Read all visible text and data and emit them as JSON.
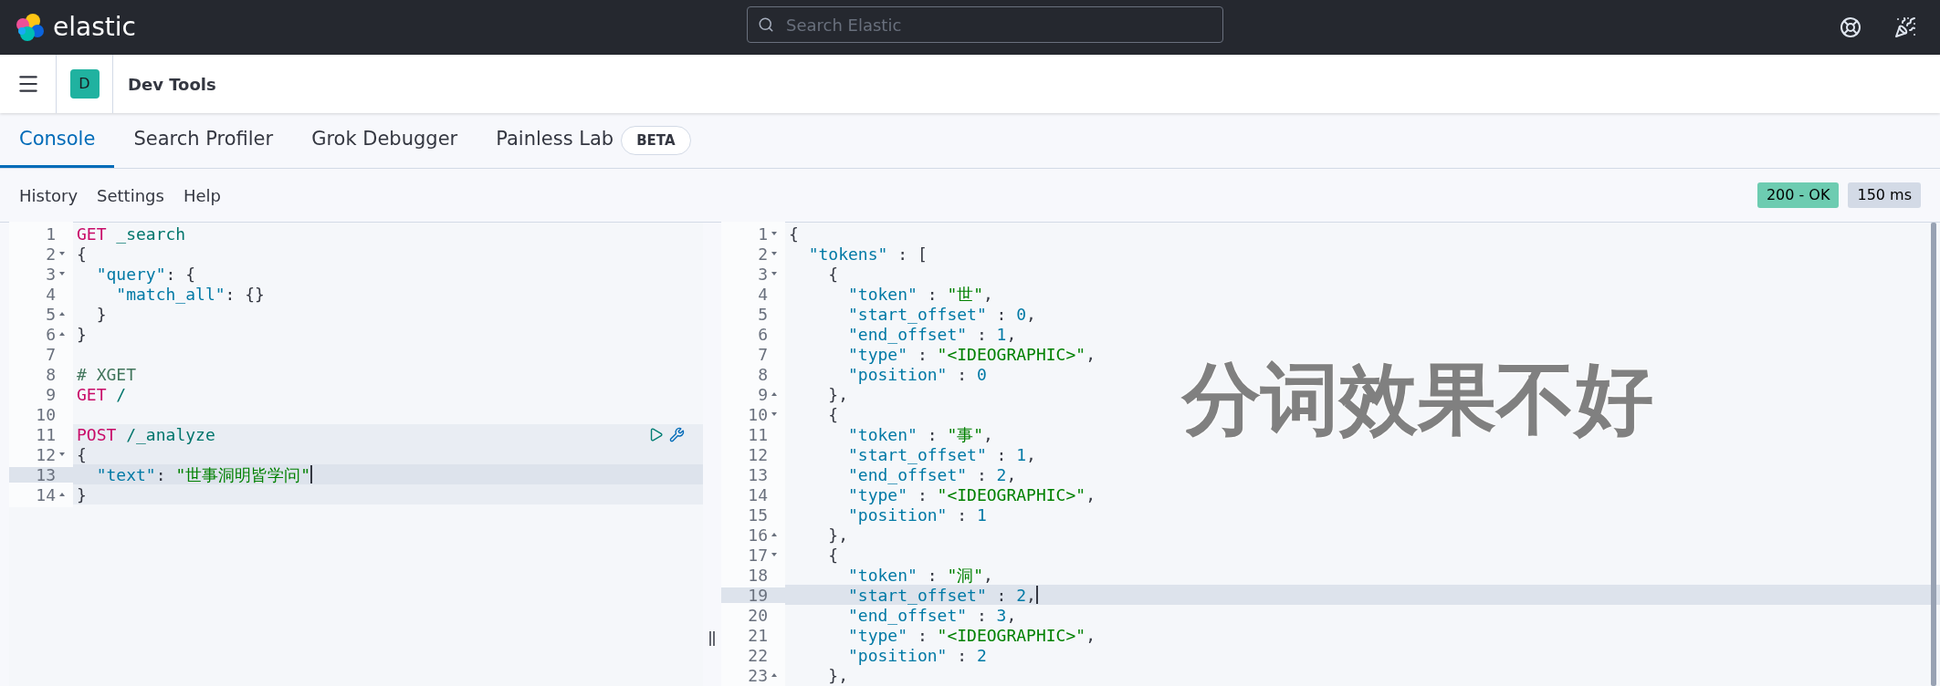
{
  "header": {
    "brand": "elastic",
    "search": {
      "placeholder": "Search Elastic"
    }
  },
  "breadcrumb": {
    "avatar": "D",
    "title": "Dev Tools"
  },
  "tabs": [
    {
      "label": "Console",
      "selected": true
    },
    {
      "label": "Search Profiler",
      "selected": false
    },
    {
      "label": "Grok Debugger",
      "selected": false
    },
    {
      "label": "Painless Lab",
      "selected": false,
      "badge": "BETA"
    }
  ],
  "toolbar": {
    "links": [
      "History",
      "Settings",
      "Help"
    ],
    "status": "200 - OK",
    "duration": "150 ms"
  },
  "request_editor": {
    "lines": [
      {
        "number": "1",
        "tokens": [
          {
            "kind": "method",
            "text": "GET"
          },
          {
            "kind": "path",
            "text": " _search"
          }
        ]
      },
      {
        "number": "2",
        "fold_start": true,
        "tokens": [
          {
            "kind": "punct",
            "text": "{"
          }
        ]
      },
      {
        "number": "3",
        "fold_start": true,
        "tokens": [
          {
            "kind": "key",
            "text": "  \"query\""
          },
          {
            "kind": "punct",
            "text": ": {"
          }
        ]
      },
      {
        "number": "4",
        "tokens": [
          {
            "kind": "key",
            "text": "    \"match_all\""
          },
          {
            "kind": "punct",
            "text": ": {}"
          }
        ]
      },
      {
        "number": "5",
        "fold_end": true,
        "tokens": [
          {
            "kind": "punct",
            "text": "  }"
          }
        ]
      },
      {
        "number": "6",
        "fold_end": true,
        "tokens": [
          {
            "kind": "punct",
            "text": "}"
          }
        ]
      },
      {
        "number": "7"
      },
      {
        "number": "8",
        "tokens": [
          {
            "kind": "comment",
            "text": "# XGET"
          }
        ]
      },
      {
        "number": "9",
        "tokens": [
          {
            "kind": "method",
            "text": "GET"
          },
          {
            "kind": "path",
            "text": " /"
          }
        ]
      },
      {
        "number": "10"
      },
      {
        "number": "11",
        "highlighted": true,
        "actions": true,
        "tokens": [
          {
            "kind": "method",
            "text": "POST"
          },
          {
            "kind": "path",
            "text": " /_analyze"
          }
        ]
      },
      {
        "number": "12",
        "highlighted": true,
        "fold_start": true,
        "tokens": [
          {
            "kind": "punct",
            "text": "{"
          }
        ]
      },
      {
        "number": "13",
        "highlighted": true,
        "active": true,
        "cursor": true,
        "tokens": [
          {
            "kind": "key",
            "text": "  \"text\""
          },
          {
            "kind": "punct",
            "text": ": "
          },
          {
            "kind": "string",
            "text": "\"世事洞明皆学问\""
          }
        ]
      },
      {
        "number": "14",
        "highlighted": true,
        "fold_end": true,
        "tokens": [
          {
            "kind": "punct",
            "text": "}"
          }
        ]
      }
    ]
  },
  "response_editor": {
    "lines": [
      {
        "number": "1",
        "fold_start": true,
        "tokens": [
          {
            "kind": "punct",
            "text": "{"
          }
        ]
      },
      {
        "number": "2",
        "fold_start": true,
        "tokens": [
          {
            "kind": "key",
            "text": "  \"tokens\""
          },
          {
            "kind": "punct",
            "text": " : ["
          }
        ]
      },
      {
        "number": "3",
        "fold_start": true,
        "tokens": [
          {
            "kind": "punct",
            "text": "    {"
          }
        ]
      },
      {
        "number": "4",
        "tokens": [
          {
            "kind": "key",
            "text": "      \"token\""
          },
          {
            "kind": "punct",
            "text": " : "
          },
          {
            "kind": "string",
            "text": "\"世\""
          },
          {
            "kind": "punct",
            "text": ","
          }
        ]
      },
      {
        "number": "5",
        "tokens": [
          {
            "kind": "key",
            "text": "      \"start_offset\""
          },
          {
            "kind": "punct",
            "text": " : "
          },
          {
            "kind": "number",
            "text": "0"
          },
          {
            "kind": "punct",
            "text": ","
          }
        ]
      },
      {
        "number": "6",
        "tokens": [
          {
            "kind": "key",
            "text": "      \"end_offset\""
          },
          {
            "kind": "punct",
            "text": " : "
          },
          {
            "kind": "number",
            "text": "1"
          },
          {
            "kind": "punct",
            "text": ","
          }
        ]
      },
      {
        "number": "7",
        "tokens": [
          {
            "kind": "key",
            "text": "      \"type\""
          },
          {
            "kind": "punct",
            "text": " : "
          },
          {
            "kind": "string",
            "text": "\"<IDEOGRAPHIC>\""
          },
          {
            "kind": "punct",
            "text": ","
          }
        ]
      },
      {
        "number": "8",
        "tokens": [
          {
            "kind": "key",
            "text": "      \"position\""
          },
          {
            "kind": "punct",
            "text": " : "
          },
          {
            "kind": "number",
            "text": "0"
          }
        ]
      },
      {
        "number": "9",
        "fold_end": true,
        "tokens": [
          {
            "kind": "punct",
            "text": "    },"
          }
        ]
      },
      {
        "number": "10",
        "fold_start": true,
        "tokens": [
          {
            "kind": "punct",
            "text": "    {"
          }
        ]
      },
      {
        "number": "11",
        "tokens": [
          {
            "kind": "key",
            "text": "      \"token\""
          },
          {
            "kind": "punct",
            "text": " : "
          },
          {
            "kind": "string",
            "text": "\"事\""
          },
          {
            "kind": "punct",
            "text": ","
          }
        ]
      },
      {
        "number": "12",
        "tokens": [
          {
            "kind": "key",
            "text": "      \"start_offset\""
          },
          {
            "kind": "punct",
            "text": " : "
          },
          {
            "kind": "number",
            "text": "1"
          },
          {
            "kind": "punct",
            "text": ","
          }
        ]
      },
      {
        "number": "13",
        "tokens": [
          {
            "kind": "key",
            "text": "      \"end_offset\""
          },
          {
            "kind": "punct",
            "text": " : "
          },
          {
            "kind": "number",
            "text": "2"
          },
          {
            "kind": "punct",
            "text": ","
          }
        ]
      },
      {
        "number": "14",
        "tokens": [
          {
            "kind": "key",
            "text": "      \"type\""
          },
          {
            "kind": "punct",
            "text": " : "
          },
          {
            "kind": "string",
            "text": "\"<IDEOGRAPHIC>\""
          },
          {
            "kind": "punct",
            "text": ","
          }
        ]
      },
      {
        "number": "15",
        "tokens": [
          {
            "kind": "key",
            "text": "      \"position\""
          },
          {
            "kind": "punct",
            "text": " : "
          },
          {
            "kind": "number",
            "text": "1"
          }
        ]
      },
      {
        "number": "16",
        "fold_end": true,
        "tokens": [
          {
            "kind": "punct",
            "text": "    },"
          }
        ]
      },
      {
        "number": "17",
        "fold_start": true,
        "tokens": [
          {
            "kind": "punct",
            "text": "    {"
          }
        ]
      },
      {
        "number": "18",
        "tokens": [
          {
            "kind": "key",
            "text": "      \"token\""
          },
          {
            "kind": "punct",
            "text": " : "
          },
          {
            "kind": "string",
            "text": "\"洞\""
          },
          {
            "kind": "punct",
            "text": ","
          }
        ]
      },
      {
        "number": "19",
        "active": true,
        "cursor": true,
        "tokens": [
          {
            "kind": "key",
            "text": "      \"start_offset\""
          },
          {
            "kind": "punct",
            "text": " : "
          },
          {
            "kind": "number",
            "text": "2"
          },
          {
            "kind": "punct",
            "text": ","
          }
        ]
      },
      {
        "number": "20",
        "tokens": [
          {
            "kind": "key",
            "text": "      \"end_offset\""
          },
          {
            "kind": "punct",
            "text": " : "
          },
          {
            "kind": "number",
            "text": "3"
          },
          {
            "kind": "punct",
            "text": ","
          }
        ]
      },
      {
        "number": "21",
        "tokens": [
          {
            "kind": "key",
            "text": "      \"type\""
          },
          {
            "kind": "punct",
            "text": " : "
          },
          {
            "kind": "string",
            "text": "\"<IDEOGRAPHIC>\""
          },
          {
            "kind": "punct",
            "text": ","
          }
        ]
      },
      {
        "number": "22",
        "tokens": [
          {
            "kind": "key",
            "text": "      \"position\""
          },
          {
            "kind": "punct",
            "text": " : "
          },
          {
            "kind": "number",
            "text": "2"
          }
        ]
      },
      {
        "number": "23",
        "fold_end": true,
        "tokens": [
          {
            "kind": "punct",
            "text": "    },"
          }
        ]
      }
    ]
  },
  "annotation": "分词效果不好"
}
